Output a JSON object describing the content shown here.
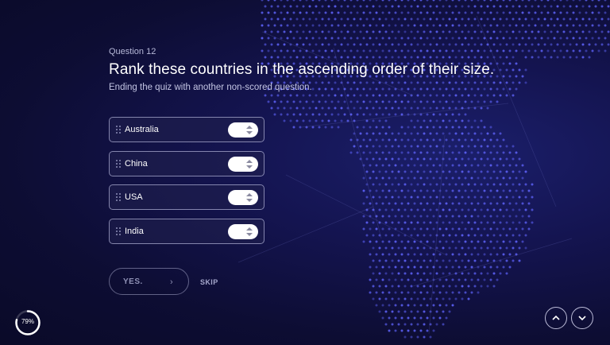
{
  "question": {
    "number_label": "Question 12",
    "title": "Rank these countries in the ascending order of their size.",
    "subtitle": "Ending the quiz with another non-scored question."
  },
  "ranking": {
    "items": [
      {
        "label": "Australia"
      },
      {
        "label": "China"
      },
      {
        "label": "USA"
      },
      {
        "label": "India"
      }
    ]
  },
  "actions": {
    "confirm_label": "YES.",
    "skip_label": "SKIP"
  },
  "progress": {
    "label": "79%",
    "value": 0.79
  },
  "icons": {
    "drag": "drag-handle-icon",
    "stepper": "up-down-stepper-icon",
    "confirm": "chevron-right-icon",
    "prev": "chevron-up-icon",
    "next": "chevron-down-icon"
  },
  "colors": {
    "background": "#0d0d33",
    "dots": "#5a5ef0",
    "text": "#ffffff"
  }
}
